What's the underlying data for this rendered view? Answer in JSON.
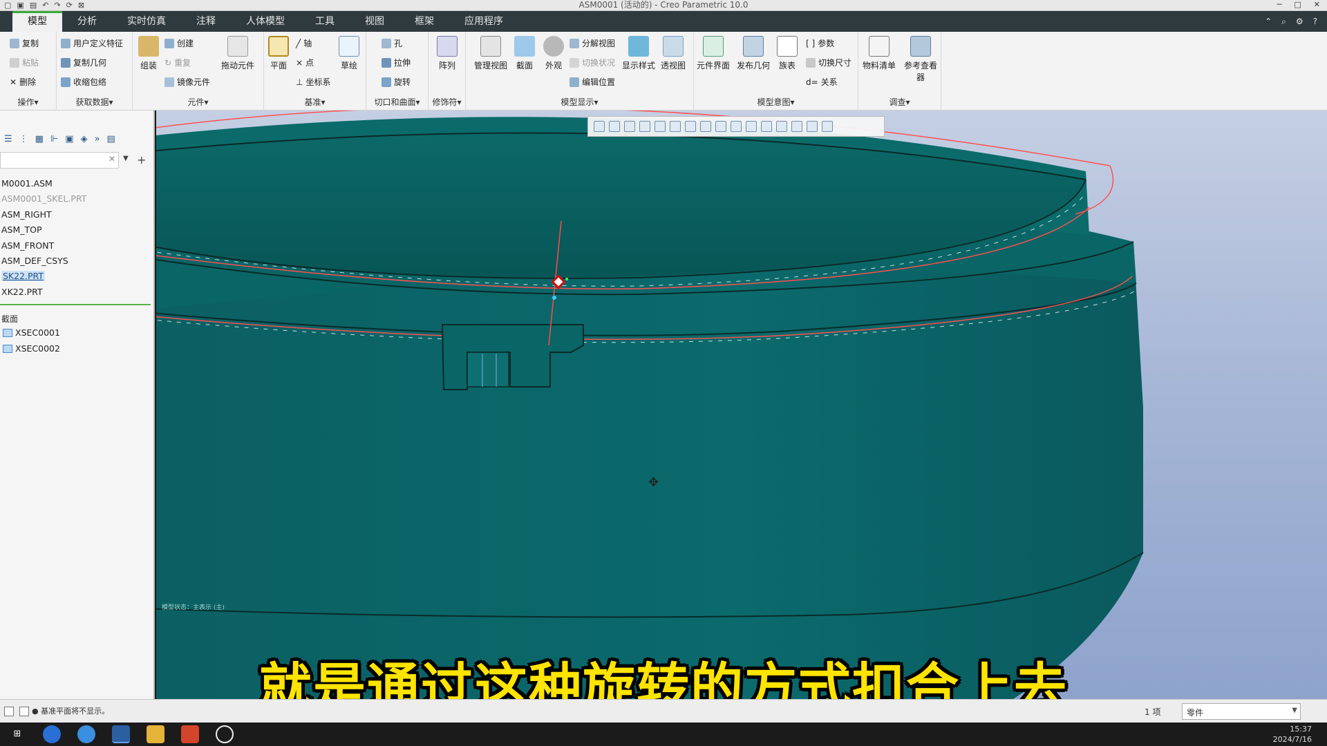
{
  "window": {
    "title": "ASM0001 (活动的) - Creo Parametric 10.0",
    "controls": [
      "─",
      "□",
      "✕"
    ]
  },
  "tabs": [
    {
      "label": "模型",
      "active": true
    },
    {
      "label": "分析"
    },
    {
      "label": "实时仿真"
    },
    {
      "label": "注释"
    },
    {
      "label": "人体模型"
    },
    {
      "label": "工具"
    },
    {
      "label": "视图"
    },
    {
      "label": "框架"
    },
    {
      "label": "应用程序"
    }
  ],
  "ribbon": {
    "operations": {
      "label": "操作▾",
      "copy": "复制",
      "paste": "粘贴",
      "delete": "删除"
    },
    "get_data": {
      "label": "获取数据▾",
      "udf": "用户定义特征",
      "copy_geom": "复制几何",
      "shrinkwrap": "收缩包络"
    },
    "component": {
      "label": "元件▾",
      "assemble": "组装",
      "create": "创建",
      "repeat": "重复",
      "mirror": "镜像元件",
      "drag": "拖动元件"
    },
    "datum": {
      "label": "基准▾",
      "plane": "平面",
      "axis": "轴",
      "point": "点",
      "csys": "坐标系",
      "sketch": "草绘"
    },
    "cut_surface": {
      "label": "切口和曲面▾",
      "hole": "孔",
      "extrude": "拉伸",
      "revolve": "旋转"
    },
    "modifiers": {
      "label": "修饰符▾",
      "pattern": "阵列"
    },
    "model_display": {
      "label": "模型显示▾",
      "manage_views": "管理视图",
      "section": "截面",
      "appearance": "外观",
      "explode_view": "分解视图",
      "toggle_status": "切换状况",
      "edit_position": "编辑位置",
      "display_style": "显示样式",
      "perspective": "透视图"
    },
    "model_intent": {
      "label": "模型意图▾",
      "component_interface": "元件界面",
      "publish_geom": "发布几何",
      "family_table": "族表",
      "params": "参数",
      "switch_dims": "切换尺寸",
      "relations": "关系"
    },
    "investigate": {
      "label": "调查▾",
      "bom": "物料清单",
      "ref_viewer": "参考查看器"
    }
  },
  "model_tree": {
    "items": [
      {
        "label": "M0001.ASM"
      },
      {
        "label": "ASM0001_SKEL.PRT",
        "dim": true
      },
      {
        "label": "ASM_RIGHT"
      },
      {
        "label": "ASM_TOP"
      },
      {
        "label": "ASM_FRONT"
      },
      {
        "label": "ASM_DEF_CSYS"
      },
      {
        "label": "SK22.PRT",
        "selected": true
      },
      {
        "label": "XK22.PRT"
      }
    ],
    "sections_header": "截面",
    "sections": [
      "XSEC0001",
      "XSEC0002"
    ]
  },
  "viewport": {
    "hint": "模型状态：主表示 (主)"
  },
  "status": {
    "message": "● 基准平面将不显示。",
    "count": "1 项",
    "filter": "零件"
  },
  "taskbar": {
    "clock_time": "15:37",
    "clock_date": "2024/7/16"
  },
  "subtitle": "就是通过这种旋转的方式扣合上去",
  "colors": {
    "model_teal": "#0a6b6b",
    "ribbon_tab_bg": "#2f3a3f",
    "active_tab_accent": "#3aa83a",
    "subtitle_yellow": "#ffe400"
  }
}
